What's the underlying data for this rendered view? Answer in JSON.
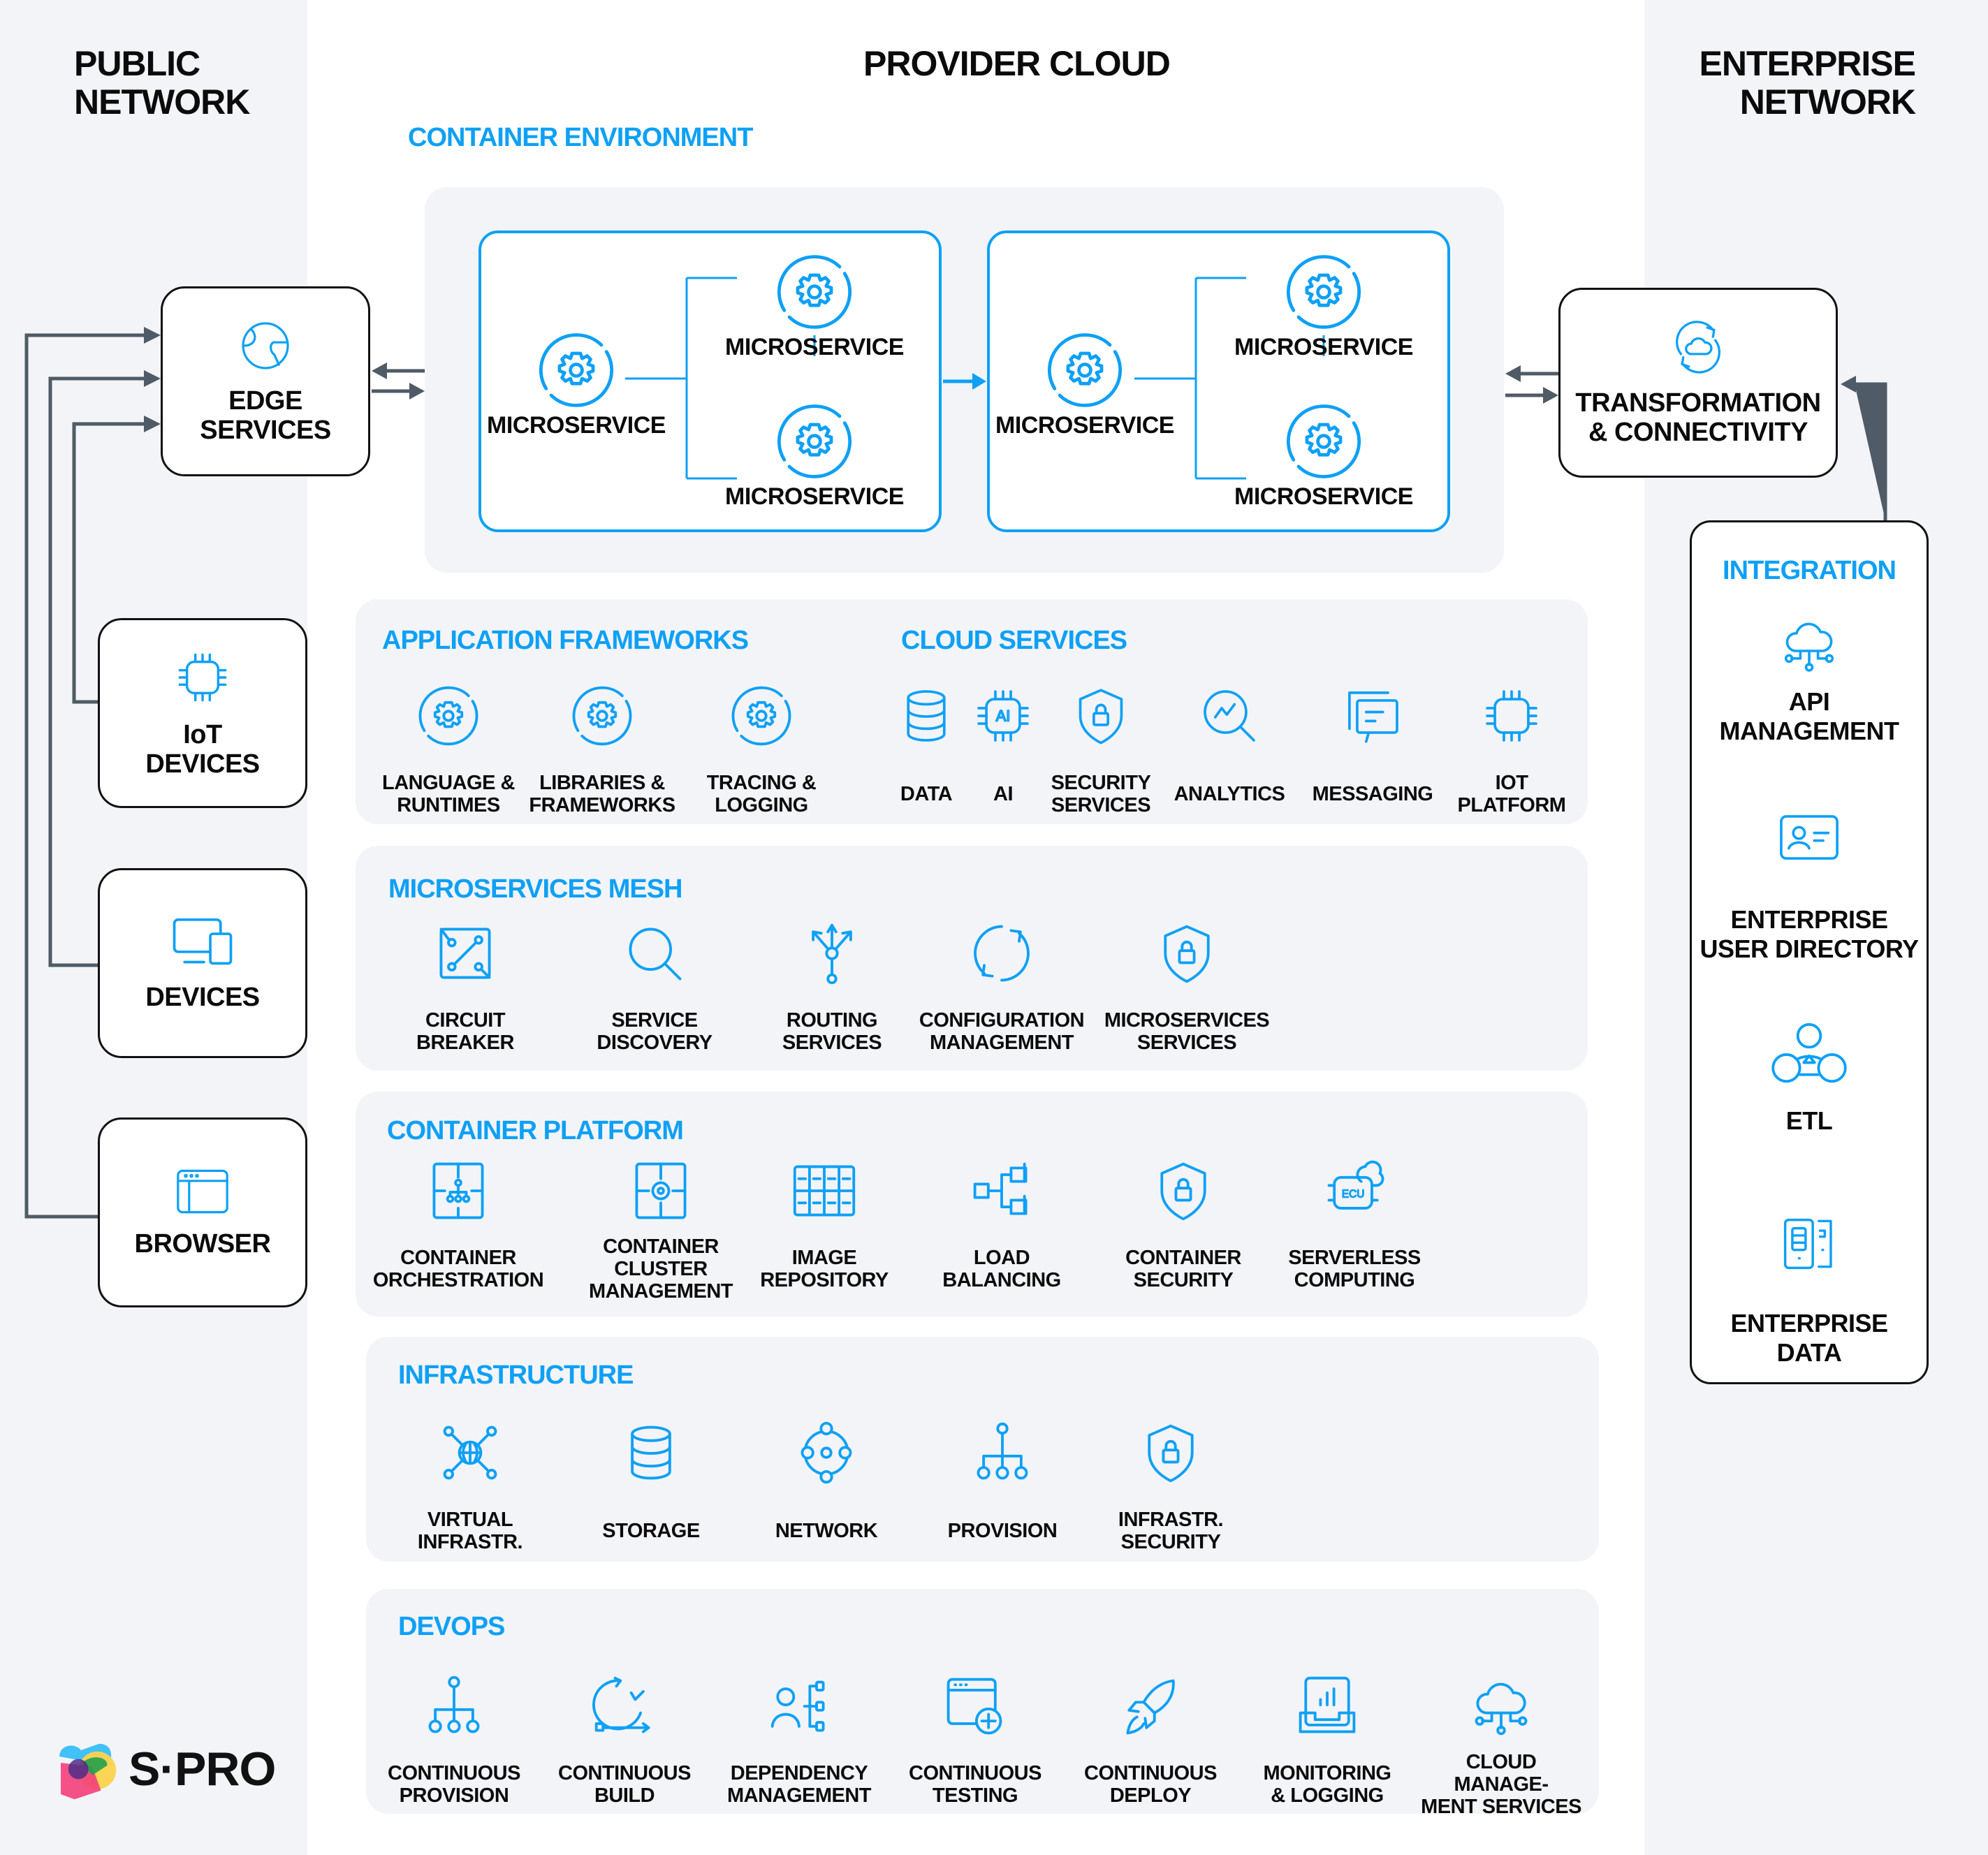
{
  "columns": {
    "public": "PUBLIC\nNETWORK",
    "provider": "PROVIDER CLOUD",
    "enterprise": "ENTERPRISE\nNETWORK"
  },
  "colors": {
    "accent": "#0EA0F5",
    "panel_bg": "#F3F4F8",
    "connector": "#4F5B66",
    "text": "#0B0B0B"
  },
  "public_network": {
    "edge_services": {
      "label": "EDGE\nSERVICES",
      "icon": "globe-icon"
    },
    "clients": [
      {
        "label": "IoT\nDEVICES",
        "icon": "chip-icon"
      },
      {
        "label": "DEVICES",
        "icon": "devices-icon"
      },
      {
        "label": "BROWSER",
        "icon": "browser-window-icon"
      }
    ]
  },
  "container_environment": {
    "title": "CONTAINER ENVIRONMENT",
    "clusters": [
      {
        "services": [
          "MICROSERVICE",
          "MICROSERVICE",
          "MICROSERVICE"
        ]
      },
      {
        "services": [
          "MICROSERVICE",
          "MICROSERVICE",
          "MICROSERVICE"
        ]
      }
    ]
  },
  "sections": {
    "app_frameworks": {
      "title": "APPLICATION FRAMEWORKS",
      "items": [
        {
          "label": "LANGUAGE &\nRUNTIMES",
          "icon": "gear-cycle-icon"
        },
        {
          "label": "LIBRARIES &\nFRAMEWORKS",
          "icon": "gear-cycle-icon"
        },
        {
          "label": "TRACING &\nLOGGING",
          "icon": "gear-cycle-icon"
        }
      ]
    },
    "cloud_services": {
      "title": "CLOUD SERVICES",
      "items": [
        {
          "label": "DATA",
          "icon": "database-icon"
        },
        {
          "label": "AI",
          "icon": "ai-chip-icon"
        },
        {
          "label": "SECURITY\nSERVICES",
          "icon": "shield-lock-icon"
        },
        {
          "label": "ANALYTICS",
          "icon": "analytics-magnifier-icon"
        },
        {
          "label": "MESSAGING",
          "icon": "chat-message-icon"
        },
        {
          "label": "IOT\nPLATFORM",
          "icon": "chip-icon"
        }
      ]
    },
    "mesh": {
      "title": "MICROSERVICES MESH",
      "items": [
        {
          "label": "CIRCUIT\nBREAKER",
          "icon": "circuit-breaker-icon"
        },
        {
          "label": "SERVICE\nDISCOVERY",
          "icon": "search-icon"
        },
        {
          "label": "ROUTING\nSERVICES",
          "icon": "routing-arrows-icon"
        },
        {
          "label": "CONFIGURATION\nMANAGEMENT",
          "icon": "refresh-cycle-icon"
        },
        {
          "label": "MICROSERVICES\nSERVICES",
          "icon": "shield-lock-icon"
        }
      ]
    },
    "container_platform": {
      "title": "CONTAINER PLATFORM",
      "items": [
        {
          "label": "CONTAINER\nORCHESTRATION",
          "icon": "container-hierarchy-icon"
        },
        {
          "label": "CONTAINER\nCLUSTER\nMANAGEMENT",
          "icon": "container-gear-icon"
        },
        {
          "label": "IMAGE\nREPOSITORY",
          "icon": "grid-repository-icon"
        },
        {
          "label": "LOAD BALANCING",
          "icon": "load-balancer-icon"
        },
        {
          "label": "CONTAINER\nSECURITY",
          "icon": "shield-lock-icon"
        },
        {
          "label": "SERVERLESS\nCOMPUTING",
          "icon": "ecu-cloud-icon"
        }
      ]
    },
    "infrastructure": {
      "title": "INFRASTRUCTURE",
      "items": [
        {
          "label": "VIRTUAL\nINFRASTR.",
          "icon": "globe-network-icon"
        },
        {
          "label": "STORAGE",
          "icon": "database-icon"
        },
        {
          "label": "NETWORK",
          "icon": "network-nodes-icon"
        },
        {
          "label": "PROVISION",
          "icon": "hierarchy-icon"
        },
        {
          "label": "INFRASTR.\nSECURITY",
          "icon": "shield-lock-icon"
        }
      ]
    },
    "devops": {
      "title": "DEVOPS",
      "items": [
        {
          "label": "CONTINUOUS\nPROVISION",
          "icon": "hierarchy-icon"
        },
        {
          "label": "CONTINUOUS\nBUILD",
          "icon": "build-cycle-icon"
        },
        {
          "label": "DEPENDENCY\nMANAGEMENT",
          "icon": "user-tree-icon"
        },
        {
          "label": "CONTINUOUS\nTESTING",
          "icon": "window-plus-icon"
        },
        {
          "label": "CONTINUOUS\nDEPLOY",
          "icon": "rocket-icon"
        },
        {
          "label": "MONITORING\n& LOGGING",
          "icon": "monitor-chart-icon"
        },
        {
          "label": "CLOUD MANAGE-\nMENT SERVICES",
          "icon": "cloud-network-icon"
        }
      ]
    }
  },
  "enterprise_network": {
    "transformation": {
      "label": "TRANSFORMATION\n& CONNECTIVITY",
      "icon": "cloud-sync-icon"
    },
    "integration": {
      "title": "INTEGRATION",
      "items": [
        {
          "label": "API\nMANAGEMENT",
          "icon": "cloud-network-icon"
        },
        {
          "label": "ENTERPRISE\nUSER DIRECTORY",
          "icon": "id-card-icon"
        },
        {
          "label": "ETL",
          "icon": "etl-circles-icon"
        },
        {
          "label": "ENTERPRISE\nDATA",
          "icon": "data-devices-icon"
        }
      ]
    }
  },
  "brand": {
    "name": "S·PRO"
  }
}
